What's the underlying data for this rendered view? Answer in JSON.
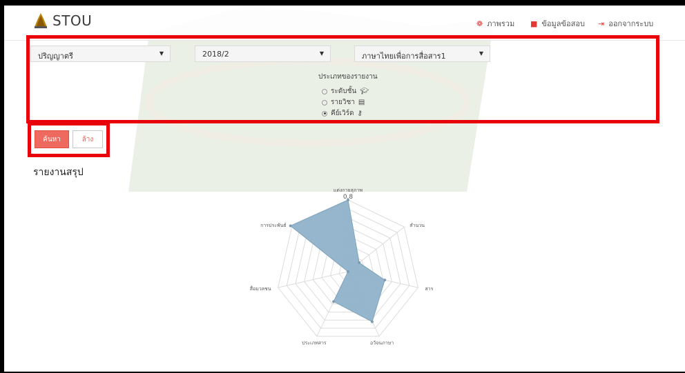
{
  "app": {
    "brand": "STOU"
  },
  "nav": [
    {
      "label": "ภาพรวม",
      "icon": "dashboard-icon"
    },
    {
      "label": "ข้อมูลข้อสอบ",
      "icon": "book-icon"
    },
    {
      "label": "ออกจากระบบ",
      "icon": "logout-icon"
    }
  ],
  "filters": {
    "level": "ปริญญาตรี",
    "term": "2018/2",
    "course": "ภาษาไทยเพื่อการสื่อสาร1"
  },
  "report_type": {
    "title": "ประเภทของรายงาน",
    "options": [
      {
        "label": "ระดับชั้น",
        "icon": "graduation-cap-icon",
        "checked": false
      },
      {
        "label": "รายวิชา",
        "icon": "book-icon",
        "checked": false
      },
      {
        "label": "คีย์เวิร์ด",
        "icon": "key-icon",
        "checked": true
      }
    ]
  },
  "buttons": {
    "search": "ค้นหา",
    "clear": "ล้าง"
  },
  "summary": {
    "title": "รายงานสรุป"
  },
  "colors": {
    "accent": "#ef6a5e",
    "annotation": "#e8000b",
    "radar_fill": "#8fb2c9"
  },
  "chart_data": {
    "type": "radar",
    "categories": [
      "แต่งกายสุภาพ",
      "สำนวน",
      "สาร",
      "อวัจนภาษา",
      "ประเภทสาร",
      "สื่อมวลชน",
      "การประพันธ์"
    ],
    "values": [
      0.8,
      0.16,
      0.42,
      0.62,
      0.37,
      0.0,
      0.82
    ],
    "rmax": 0.8,
    "rings": 8,
    "tick_label": "0.8",
    "grid": true
  }
}
